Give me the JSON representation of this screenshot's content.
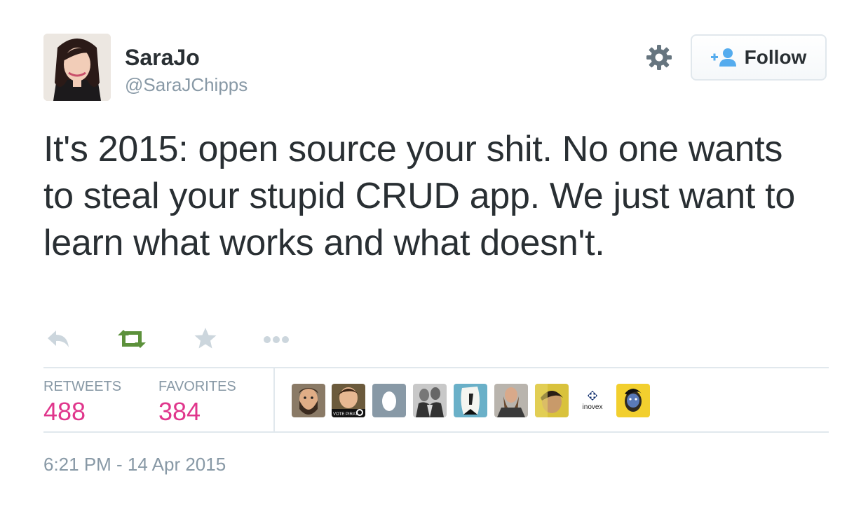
{
  "user": {
    "display_name": "SaraJo",
    "screen_name": "@SaraJChipps",
    "avatar_icon": "profile-photo"
  },
  "follow_button": {
    "label": "Follow",
    "icon": "add-user-icon",
    "icon_color": "#55acee"
  },
  "settings_icon": "gear-icon",
  "tweet": {
    "text": "It's 2015: open source your shit. No one wants to steal your stupid CRUD app. We just want to learn what works and what doesn't."
  },
  "actions": [
    {
      "name": "reply",
      "icon": "reply-icon",
      "color": "#ccd6dd"
    },
    {
      "name": "retweet",
      "icon": "retweet-icon",
      "color": "#5c913b"
    },
    {
      "name": "favorite",
      "icon": "star-icon",
      "color": "#ccd6dd"
    },
    {
      "name": "more",
      "icon": "more-dots-icon",
      "color": "#ccd6dd"
    }
  ],
  "stats": {
    "retweets_label": "RETWEETS",
    "retweets_value": "488",
    "favorites_label": "FAVORITES",
    "favorites_value": "384",
    "value_color": "#e0368c"
  },
  "faces": {
    "vote_pirate_text": "VOTE PIRATE",
    "inovex_text": "inovex"
  },
  "timestamp": "6:21 PM - 14 Apr 2015"
}
